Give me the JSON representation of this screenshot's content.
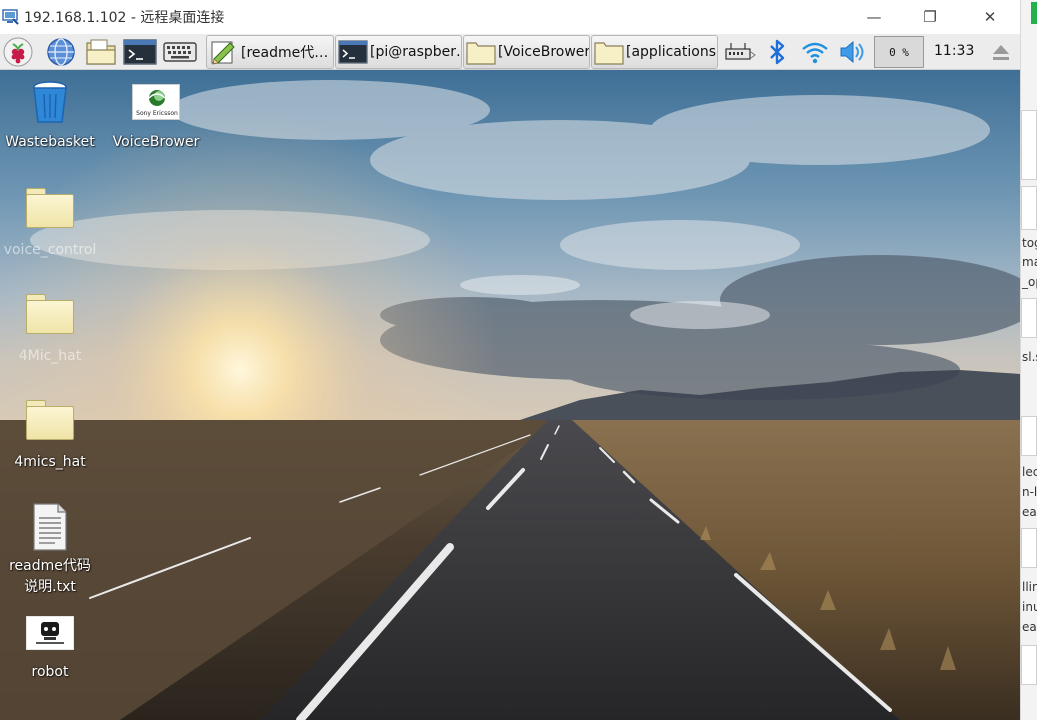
{
  "window": {
    "title": "192.168.1.102 - 远程桌面连接",
    "minimize_glyph": "—",
    "restore_glyph": "❐",
    "close_glyph": "✕"
  },
  "panel": {
    "icons": [
      "raspberry-menu-icon",
      "web-browser-icon",
      "file-manager-icon",
      "terminal-icon",
      "keyboard-icon"
    ],
    "tasks": [
      {
        "label": "[readme代…",
        "icon": "text-editor-icon"
      },
      {
        "label": "[pi@raspber…",
        "icon": "terminal-icon"
      },
      {
        "label": "[VoiceBrower]",
        "icon": "folder-icon"
      },
      {
        "label": "[applications]",
        "icon": "folder-icon"
      }
    ],
    "tray_icons": [
      "network-icon",
      "bluetooth-icon",
      "wifi-icon",
      "volume-icon",
      "eject-icon"
    ],
    "cpu_usage": "0 %",
    "clock": "11:33"
  },
  "desktop": {
    "icons": [
      {
        "label": "Wastebasket",
        "icon": "trash-icon"
      },
      {
        "label": "VoiceBrower",
        "icon": "sony-ericsson-icon",
        "icon_text": "Sony Ericsson"
      },
      {
        "label": "voice_control",
        "icon": "folder-icon"
      },
      {
        "label": "4Mic_hat",
        "icon": "folder-icon"
      },
      {
        "label": "4mics_hat",
        "icon": "folder-icon"
      },
      {
        "label": "readme代码说明.txt",
        "icon": "text-file-icon"
      },
      {
        "label": "robot",
        "icon": "robot-image-icon"
      }
    ]
  },
  "side_window": {
    "fragments": [
      "tog",
      "ma",
      "_op",
      "sl.s",
      "lec",
      "n-li",
      "eab",
      "llin",
      "inu",
      "eab"
    ]
  }
}
